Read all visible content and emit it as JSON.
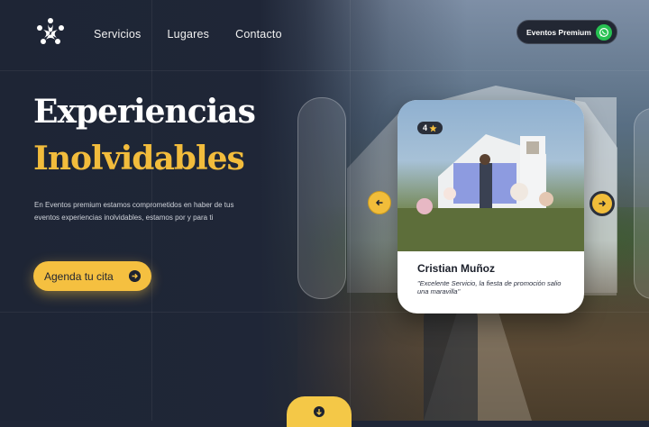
{
  "nav": {
    "items": [
      {
        "label": "Servicios"
      },
      {
        "label": "Lugares"
      },
      {
        "label": "Contacto"
      }
    ],
    "premium_label": "Eventos Premium"
  },
  "hero": {
    "title_line1": "Experiencias",
    "title_line2": "Inolvidables",
    "description": "En Eventos premium estamos comprometidos en haber de tus eventos experiencias inolvidables, estamos por y para ti",
    "cta_label": "Agenda tu cita"
  },
  "testimonial": {
    "rating": "4",
    "name": "Cristian Muñoz",
    "quote": "\"Excelente Servicio, la fiesta de promoción salio una maravilla\""
  },
  "icons": {
    "logo": "people-circle-logo",
    "whatsapp": "whatsapp-icon",
    "star": "star-icon",
    "prev": "arrow-left-icon",
    "next": "arrow-right-icon",
    "cta": "arrow-right-circle-icon",
    "scroll": "arrow-down-icon"
  },
  "colors": {
    "accent": "#f5c040",
    "dark": "#1f2637",
    "whatsapp": "#27c152"
  }
}
